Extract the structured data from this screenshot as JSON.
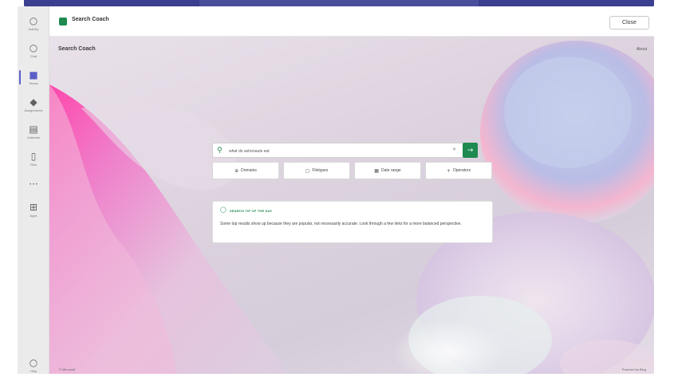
{
  "rail": {
    "items": [
      {
        "icon": "bell-icon",
        "glyph": "♫",
        "label": "Activity"
      },
      {
        "icon": "chat-icon",
        "glyph": "◯",
        "label": "Chat"
      },
      {
        "icon": "teams-icon",
        "glyph": "■",
        "label": "Teams"
      },
      {
        "icon": "assignments-icon",
        "glyph": "◆",
        "label": "Assignments"
      },
      {
        "icon": "calendar-icon",
        "glyph": "▤",
        "label": "Calendar"
      },
      {
        "icon": "files-icon",
        "glyph": "▯",
        "label": "Files"
      },
      {
        "icon": "more-icon",
        "glyph": "···",
        "label": ""
      },
      {
        "icon": "apps-icon",
        "glyph": "⊞",
        "label": "Apps"
      },
      {
        "icon": "help-icon",
        "glyph": "◯",
        "label": "Help"
      }
    ]
  },
  "header": {
    "app_title": "Search Coach",
    "close_label": "Close"
  },
  "page": {
    "title": "Search Coach",
    "about": "About",
    "footer_left": "© Microsoft",
    "footer_right": "Powered by Bing"
  },
  "search": {
    "value": "what do astronauts eat",
    "clear_glyph": "✕",
    "go_glyph": "→",
    "search_glyph": "⚲"
  },
  "filters": [
    {
      "glyph": "⊕",
      "label": "Domains"
    },
    {
      "glyph": "▢",
      "label": "Filetypes"
    },
    {
      "glyph": "▦",
      "label": "Date range"
    },
    {
      "glyph": "+",
      "label": "Operators"
    }
  ],
  "tip": {
    "icon_glyph": "♀",
    "heading": "SEARCH TIP OF THE DAY",
    "body": "Some top results show up because they are popular, not necessarily accurate. Look through a few links for a more balanced perspective."
  },
  "colors": {
    "accent": "#1e8a4f",
    "teams_purple": "#5b5fc7",
    "titlebar": "#3b3f8f"
  }
}
